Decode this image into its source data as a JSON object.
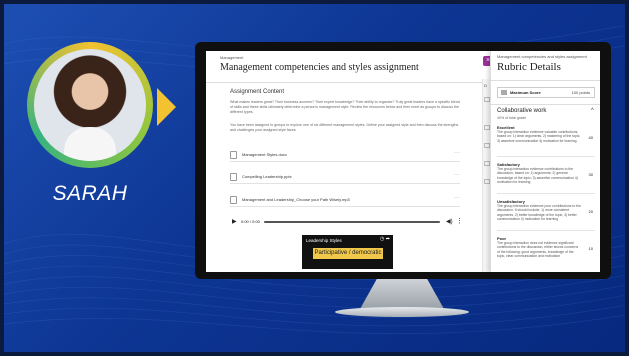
{
  "presenter": {
    "name": "SARAH",
    "avatar_icon": "person-photo",
    "ring_colors": [
      "#f2c230",
      "#8ec63f",
      "#36b37e"
    ]
  },
  "assignment": {
    "breadcrumb": "Management",
    "title": "Management competencies and styles assignment",
    "section_title": "Assignment Content",
    "paragraph_1": "What makes leaders great? Their business acumen? Their expert knowledge? Their ability to organize? Truly great leaders have a specific blend of skills and these skills ultimately determine a person's management style. Review the resources below and then meet as groups to discuss the different types.",
    "paragraph_2": "You have been assigned to groups to explore one of six different management styles. Define your assigned style and then discuss the strengths and challenges your assigned style faces.",
    "files": [
      {
        "label": "Management Styles.docx",
        "icon": "document-icon"
      },
      {
        "label": "Compelling Leadership.pptx",
        "icon": "presentation-icon"
      },
      {
        "label": "Management and Leadership_Choose your Path Wisely.mp3",
        "icon": "audio-file-icon"
      }
    ],
    "audio_time": "0:00 / 0:00",
    "video": {
      "title": "Leadership Styles",
      "banner": "Participative / democratic"
    }
  },
  "side_strip": {
    "label": "D"
  },
  "rubric": {
    "breadcrumb": "Management competencies and styles assignment",
    "title": "Rubric Details",
    "close_glyph": "×",
    "max_label": "Maximum Score",
    "max_value": "100 points",
    "criterion": {
      "name": "Collaborative work",
      "weight": "40% of total grade"
    },
    "levels": [
      {
        "name": "Excellent",
        "desc": "The group interaction evidence valuable contributions, based on: 1) clear arguments, 2) mastering of the topic; 3) assertive communication 4) motivation for learning",
        "points": "40"
      },
      {
        "name": "Satisfactory",
        "desc": "The group interaction evidence contributions to the discussion, based on: 1) arguments; 2) general knowledge of the topic; 3) assertive communication 4) motivation for learning",
        "points": "30"
      },
      {
        "name": "Unsatisfactory",
        "desc": "The group interaction evidence poor contributions to the discussion. It should include: 1) more consistent arguments, 2) better knowledge of the topic; 3) better communication 4) motivation for learning",
        "points": "20"
      },
      {
        "name": "Poor",
        "desc": "The group interaction does not evidence significant contributions to the discussion, either shows concerns of the following: good arguments, knowledge of the topic, clear communication and motivation",
        "points": "10"
      }
    ]
  }
}
